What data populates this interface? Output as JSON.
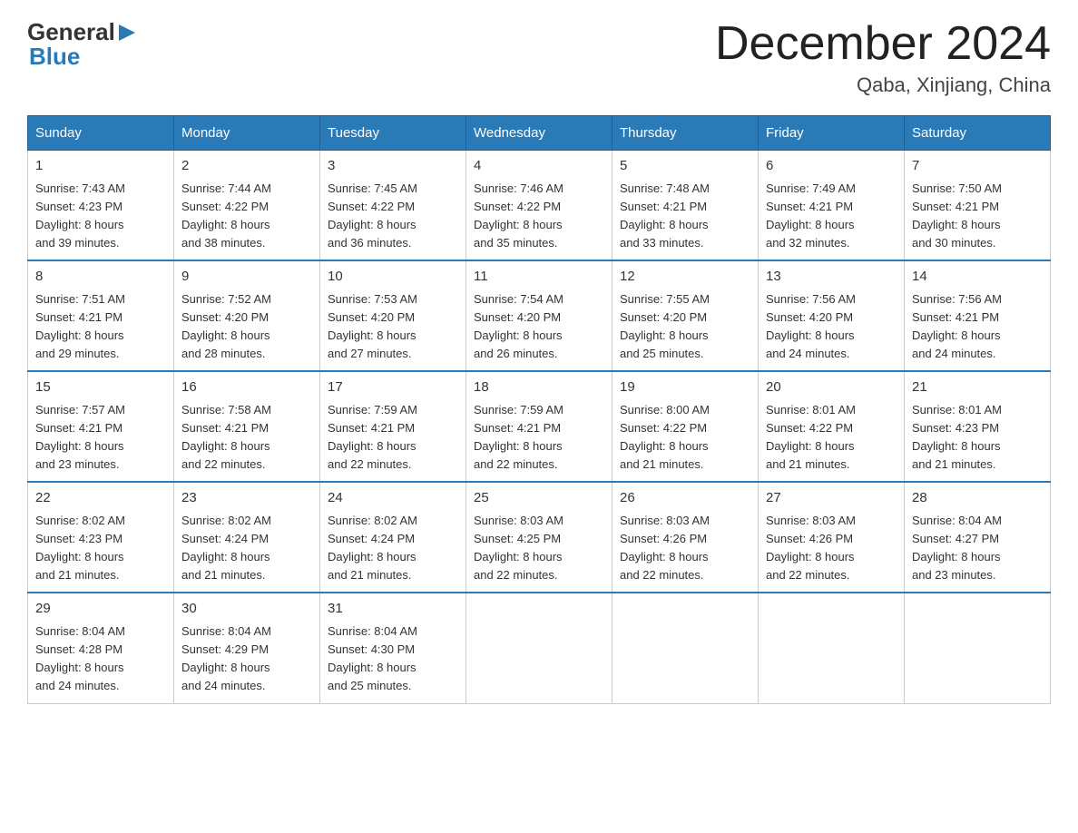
{
  "header": {
    "logo": {
      "general": "General",
      "blue": "Blue"
    },
    "title": "December 2024",
    "location": "Qaba, Xinjiang, China"
  },
  "weekdays": [
    "Sunday",
    "Monday",
    "Tuesday",
    "Wednesday",
    "Thursday",
    "Friday",
    "Saturday"
  ],
  "weeks": [
    [
      {
        "day": "1",
        "sunrise": "7:43 AM",
        "sunset": "4:23 PM",
        "daylight": "8 hours and 39 minutes."
      },
      {
        "day": "2",
        "sunrise": "7:44 AM",
        "sunset": "4:22 PM",
        "daylight": "8 hours and 38 minutes."
      },
      {
        "day": "3",
        "sunrise": "7:45 AM",
        "sunset": "4:22 PM",
        "daylight": "8 hours and 36 minutes."
      },
      {
        "day": "4",
        "sunrise": "7:46 AM",
        "sunset": "4:22 PM",
        "daylight": "8 hours and 35 minutes."
      },
      {
        "day": "5",
        "sunrise": "7:48 AM",
        "sunset": "4:21 PM",
        "daylight": "8 hours and 33 minutes."
      },
      {
        "day": "6",
        "sunrise": "7:49 AM",
        "sunset": "4:21 PM",
        "daylight": "8 hours and 32 minutes."
      },
      {
        "day": "7",
        "sunrise": "7:50 AM",
        "sunset": "4:21 PM",
        "daylight": "8 hours and 30 minutes."
      }
    ],
    [
      {
        "day": "8",
        "sunrise": "7:51 AM",
        "sunset": "4:21 PM",
        "daylight": "8 hours and 29 minutes."
      },
      {
        "day": "9",
        "sunrise": "7:52 AM",
        "sunset": "4:20 PM",
        "daylight": "8 hours and 28 minutes."
      },
      {
        "day": "10",
        "sunrise": "7:53 AM",
        "sunset": "4:20 PM",
        "daylight": "8 hours and 27 minutes."
      },
      {
        "day": "11",
        "sunrise": "7:54 AM",
        "sunset": "4:20 PM",
        "daylight": "8 hours and 26 minutes."
      },
      {
        "day": "12",
        "sunrise": "7:55 AM",
        "sunset": "4:20 PM",
        "daylight": "8 hours and 25 minutes."
      },
      {
        "day": "13",
        "sunrise": "7:56 AM",
        "sunset": "4:20 PM",
        "daylight": "8 hours and 24 minutes."
      },
      {
        "day": "14",
        "sunrise": "7:56 AM",
        "sunset": "4:21 PM",
        "daylight": "8 hours and 24 minutes."
      }
    ],
    [
      {
        "day": "15",
        "sunrise": "7:57 AM",
        "sunset": "4:21 PM",
        "daylight": "8 hours and 23 minutes."
      },
      {
        "day": "16",
        "sunrise": "7:58 AM",
        "sunset": "4:21 PM",
        "daylight": "8 hours and 22 minutes."
      },
      {
        "day": "17",
        "sunrise": "7:59 AM",
        "sunset": "4:21 PM",
        "daylight": "8 hours and 22 minutes."
      },
      {
        "day": "18",
        "sunrise": "7:59 AM",
        "sunset": "4:21 PM",
        "daylight": "8 hours and 22 minutes."
      },
      {
        "day": "19",
        "sunrise": "8:00 AM",
        "sunset": "4:22 PM",
        "daylight": "8 hours and 21 minutes."
      },
      {
        "day": "20",
        "sunrise": "8:01 AM",
        "sunset": "4:22 PM",
        "daylight": "8 hours and 21 minutes."
      },
      {
        "day": "21",
        "sunrise": "8:01 AM",
        "sunset": "4:23 PM",
        "daylight": "8 hours and 21 minutes."
      }
    ],
    [
      {
        "day": "22",
        "sunrise": "8:02 AM",
        "sunset": "4:23 PM",
        "daylight": "8 hours and 21 minutes."
      },
      {
        "day": "23",
        "sunrise": "8:02 AM",
        "sunset": "4:24 PM",
        "daylight": "8 hours and 21 minutes."
      },
      {
        "day": "24",
        "sunrise": "8:02 AM",
        "sunset": "4:24 PM",
        "daylight": "8 hours and 21 minutes."
      },
      {
        "day": "25",
        "sunrise": "8:03 AM",
        "sunset": "4:25 PM",
        "daylight": "8 hours and 22 minutes."
      },
      {
        "day": "26",
        "sunrise": "8:03 AM",
        "sunset": "4:26 PM",
        "daylight": "8 hours and 22 minutes."
      },
      {
        "day": "27",
        "sunrise": "8:03 AM",
        "sunset": "4:26 PM",
        "daylight": "8 hours and 22 minutes."
      },
      {
        "day": "28",
        "sunrise": "8:04 AM",
        "sunset": "4:27 PM",
        "daylight": "8 hours and 23 minutes."
      }
    ],
    [
      {
        "day": "29",
        "sunrise": "8:04 AM",
        "sunset": "4:28 PM",
        "daylight": "8 hours and 24 minutes."
      },
      {
        "day": "30",
        "sunrise": "8:04 AM",
        "sunset": "4:29 PM",
        "daylight": "8 hours and 24 minutes."
      },
      {
        "day": "31",
        "sunrise": "8:04 AM",
        "sunset": "4:30 PM",
        "daylight": "8 hours and 25 minutes."
      },
      null,
      null,
      null,
      null
    ]
  ],
  "labels": {
    "sunrise": "Sunrise:",
    "sunset": "Sunset:",
    "daylight": "Daylight:"
  }
}
